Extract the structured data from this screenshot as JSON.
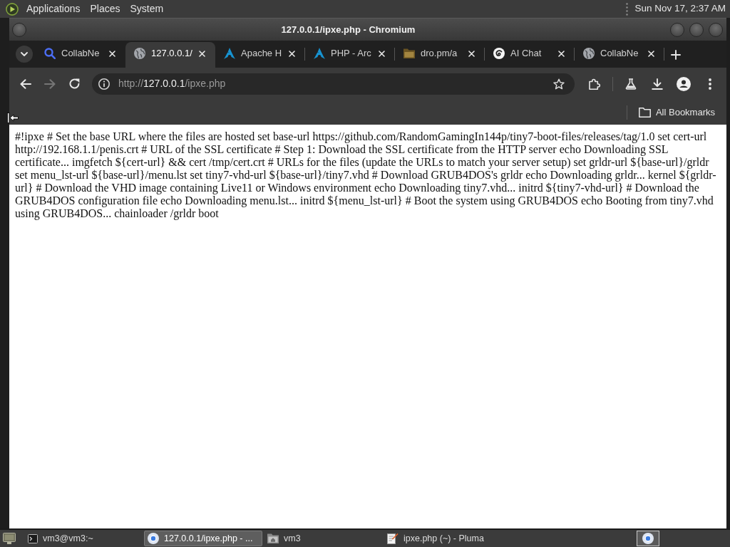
{
  "top_panel": {
    "menus": [
      "Applications",
      "Places",
      "System"
    ],
    "clock": "Sun Nov 17, 2:37 AM"
  },
  "window": {
    "title": "127.0.0.1/ipxe.php - Chromium"
  },
  "tabs": [
    {
      "title": "CollabNe",
      "kind": "search",
      "selected": false
    },
    {
      "title": "127.0.0.1/",
      "kind": "globe",
      "selected": true
    },
    {
      "title": "Apache H",
      "kind": "arch",
      "selected": false
    },
    {
      "title": "PHP - Arc",
      "kind": "arch",
      "selected": false
    },
    {
      "title": "dro.pm/a",
      "kind": "folder",
      "selected": false
    },
    {
      "title": "AI Chat",
      "kind": "chat",
      "selected": false
    },
    {
      "title": "CollabNe",
      "kind": "globe",
      "selected": false
    }
  ],
  "navigation": [
    {
      "kind": "back",
      "disabled": false
    },
    {
      "kind": "forward",
      "disabled": true
    },
    {
      "kind": "reload",
      "disabled": false
    }
  ],
  "address_bar": {
    "scheme": "http://",
    "host": "127.0.0.1",
    "path": "/ipxe.php"
  },
  "bookmarks_bar": {
    "label": "All Bookmarks"
  },
  "page": {
    "text": "#!ipxe # Set the base URL where the files are hosted set base-url https://github.com/RandomGamingIn144p/tiny7-boot-files/releases/tag/1.0 set cert-url http://192.168.1.1/penis.crt # URL of the SSL certificate # Step 1: Download the SSL certificate from the HTTP server echo Downloading SSL certificate... imgfetch ${cert-url} && cert /tmp/cert.crt # URLs for the files (update the URLs to match your server setup) set grldr-url ${base-url}/grldr set menu_lst-url ${base-url}/menu.lst set tiny7-vhd-url ${base-url}/tiny7.vhd # Download GRUB4DOS's grldr echo Downloading grldr... kernel ${grldr-url} # Download the VHD image containing Live11 or Windows environment echo Downloading tiny7.vhd... initrd ${tiny7-vhd-url} # Download the GRUB4DOS configuration file echo Downloading menu.lst... initrd ${menu_lst-url} # Boot the system using GRUB4DOS echo Booting from tiny7.vhd using GRUB4DOS... chainloader /grldr boot"
  },
  "taskbar": {
    "items": [
      {
        "label": "vm3@vm3:~",
        "kind": "terminal",
        "selected": false
      },
      {
        "label": "127.0.0.1/ipxe.php - ...",
        "kind": "browser",
        "selected": true
      },
      {
        "label": "vm3",
        "kind": "files",
        "selected": false
      },
      {
        "label": "ipxe.php (~) - Pluma",
        "kind": "editor",
        "selected": false
      }
    ]
  }
}
